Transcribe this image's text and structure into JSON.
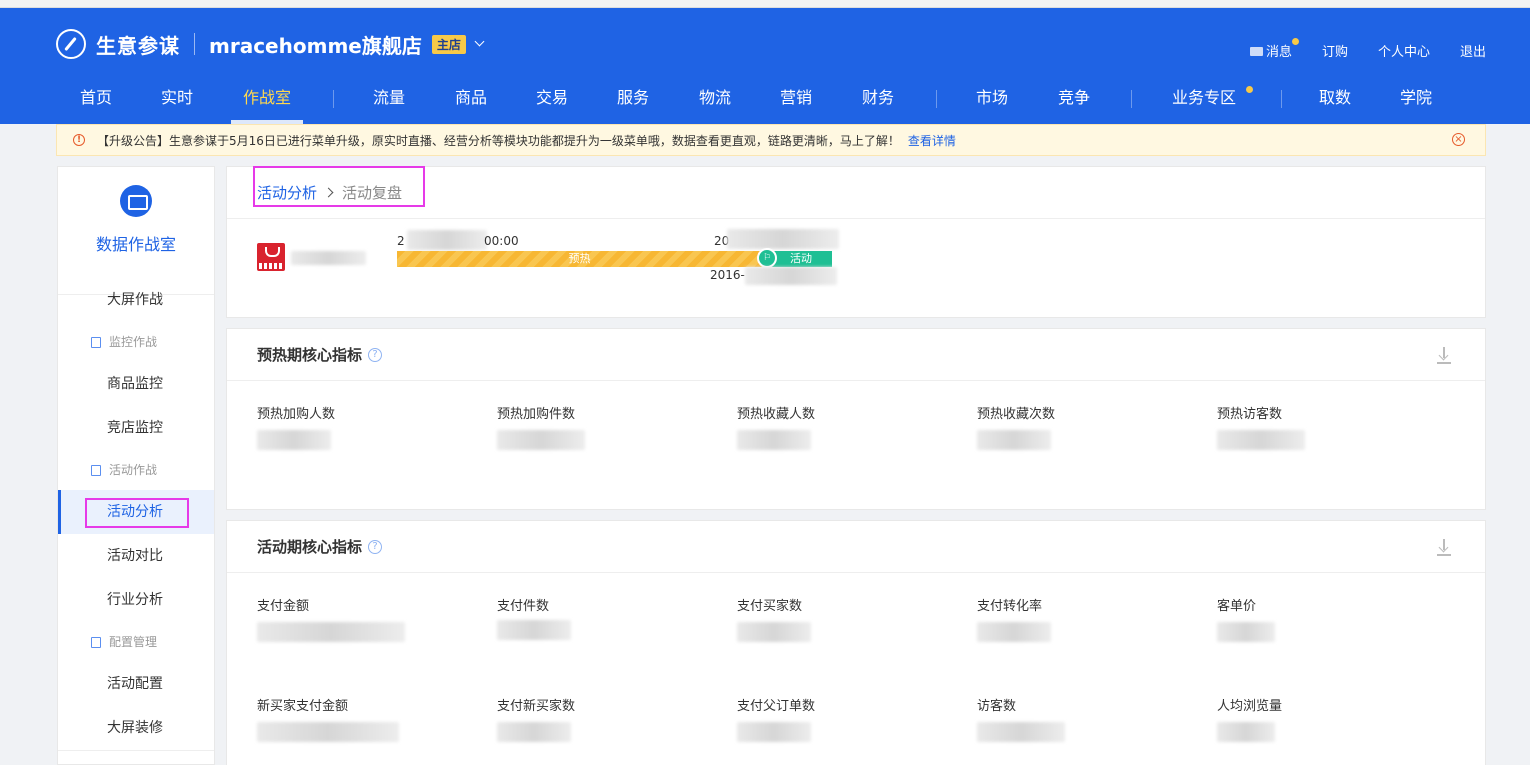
{
  "header": {
    "logo_text": "生意参谋",
    "shop_name": "mracehomme旗舰店",
    "shop_badge": "主店",
    "top_links": {
      "message": "消息",
      "subscribe": "订购",
      "profile": "个人中心",
      "logout": "退出"
    },
    "nav": [
      {
        "label": "首页"
      },
      {
        "label": "实时"
      },
      {
        "label": "作战室",
        "active": true
      },
      {
        "label": "流量"
      },
      {
        "label": "商品"
      },
      {
        "label": "交易"
      },
      {
        "label": "服务"
      },
      {
        "label": "物流"
      },
      {
        "label": "营销"
      },
      {
        "label": "财务"
      },
      {
        "label": "市场"
      },
      {
        "label": "竞争"
      },
      {
        "label": "业务专区"
      },
      {
        "label": "取数"
      },
      {
        "label": "学院"
      }
    ]
  },
  "notice": {
    "text": "【升级公告】生意参谋于5月16日已进行菜单升级，原实时直播、经营分析等模块功能都提升为一级菜单哦，数据查看更直观，链路更清晰，马上了解！",
    "link": "查看详情"
  },
  "sidebar": {
    "title": "数据作战室",
    "items": [
      {
        "type": "item",
        "label": "大屏作战"
      },
      {
        "type": "group",
        "label": "监控作战"
      },
      {
        "type": "item",
        "label": "商品监控"
      },
      {
        "type": "item",
        "label": "竞店监控"
      },
      {
        "type": "group",
        "label": "活动作战"
      },
      {
        "type": "item",
        "label": "活动分析",
        "active": true
      },
      {
        "type": "item",
        "label": "活动对比"
      },
      {
        "type": "item",
        "label": "行业分析"
      },
      {
        "type": "group",
        "label": "配置管理"
      },
      {
        "type": "item",
        "label": "活动配置"
      },
      {
        "type": "item",
        "label": "大屏装修"
      }
    ]
  },
  "breadcrumb": {
    "parent": "活动分析",
    "current": "活动复盘"
  },
  "timeline": {
    "start_prefix": "2",
    "start_suffix": "00:00",
    "mid_prefix": "20",
    "end_prefix": "2016-",
    "preheat_label": "预热",
    "activity_label": "活动",
    "flag_glyph": "⚐"
  },
  "preheat_section": {
    "title": "预热期核心指标",
    "metrics": [
      {
        "label": "预热加购人数"
      },
      {
        "label": "预热加购件数"
      },
      {
        "label": "预热收藏人数"
      },
      {
        "label": "预热收藏次数"
      },
      {
        "label": "预热访客数"
      }
    ]
  },
  "activity_section": {
    "title": "活动期核心指标",
    "metrics": [
      {
        "label": "支付金额"
      },
      {
        "label": "支付件数"
      },
      {
        "label": "支付买家数"
      },
      {
        "label": "支付转化率"
      },
      {
        "label": "客单价"
      },
      {
        "label": "新买家支付金额"
      },
      {
        "label": "支付新买家数"
      },
      {
        "label": "支付父订单数"
      },
      {
        "label": "访客数"
      },
      {
        "label": "人均浏览量"
      }
    ]
  },
  "icons": {
    "help": "?",
    "notice_info": "!",
    "notice_close": "×"
  },
  "colors": {
    "brand": "#1f63e4",
    "preheat": "#f7b733",
    "activity": "#1fbf94",
    "highlight": "#e63ae8"
  }
}
